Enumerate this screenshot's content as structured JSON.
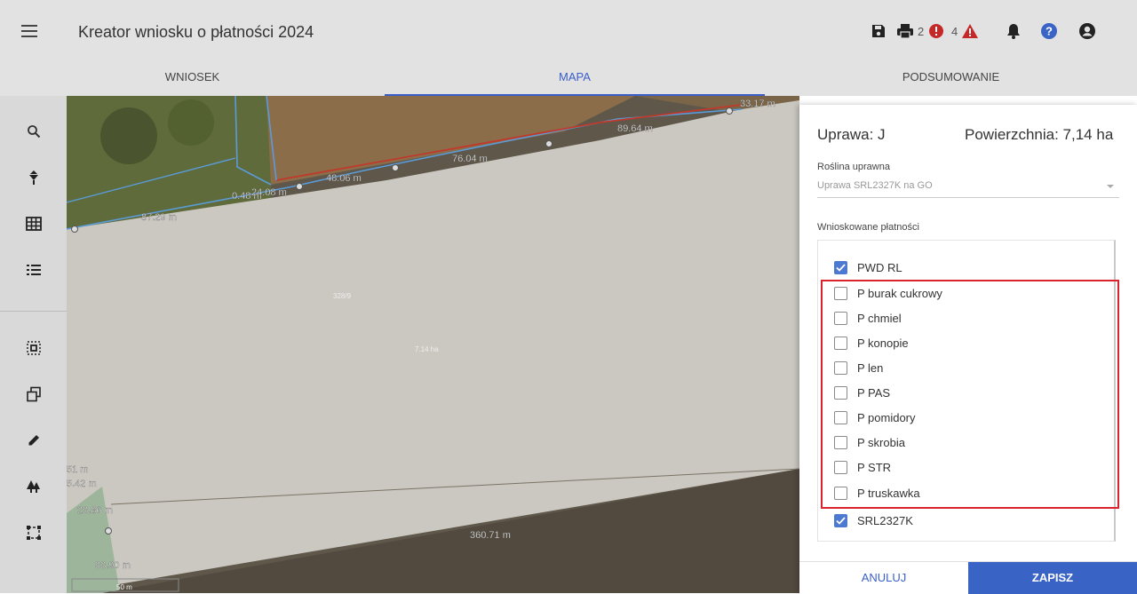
{
  "header": {
    "title": "Kreator wniosku o płatności 2024",
    "error_count": "2",
    "warning_count": "4",
    "icons": [
      "menu-icon",
      "save-icon",
      "print-icon",
      "error-icon",
      "warning-icon",
      "bell-icon",
      "help-icon",
      "user-icon"
    ]
  },
  "tabs": [
    {
      "label": "WNIOSEK",
      "active": false
    },
    {
      "label": "MAPA",
      "active": true
    },
    {
      "label": "PODSUMOWANIE",
      "active": false
    }
  ],
  "sidebar": {
    "tools": [
      "search-icon",
      "pin-icon",
      "grid-icon",
      "list-icon",
      "select-area-icon",
      "copy-icon",
      "pencil-icon",
      "trees-icon",
      "bounding-box-icon"
    ]
  },
  "map": {
    "labels": [
      "87.29 m",
      "0.48 m",
      "24.08 m",
      "48.06 m",
      "76.04 m",
      "89.64 m",
      "33.17 m",
      "328/9",
      "7.14 ha",
      "51 m",
      "5.42 m",
      "23.86 m",
      "33.90 m",
      "360.71 m",
      "50 m"
    ]
  },
  "panel": {
    "crop_label": "Uprawa: J",
    "area_label": "Powierzchnia: 7,14 ha",
    "plant_field_label": "Roślina uprawna",
    "plant_value": "Uprawa SRL2327K na GO",
    "payments_label": "Wnioskowane płatności",
    "payments": [
      {
        "label": "PWD RL",
        "checked": true
      },
      {
        "label": "P burak cukrowy",
        "checked": false
      },
      {
        "label": "P chmiel",
        "checked": false
      },
      {
        "label": "P konopie",
        "checked": false
      },
      {
        "label": "P len",
        "checked": false
      },
      {
        "label": "P PAS",
        "checked": false
      },
      {
        "label": "P pomidory",
        "checked": false
      },
      {
        "label": "P skrobia",
        "checked": false
      },
      {
        "label": "P STR",
        "checked": false
      },
      {
        "label": "P truskawka",
        "checked": false
      },
      {
        "label": "SRL2327K",
        "checked": true
      }
    ],
    "cancel_label": "ANULUJ",
    "save_label": "ZAPISZ"
  },
  "colors": {
    "accent": "#3a63c6",
    "highlight": "#d9232e",
    "error": "#c62828",
    "warning": "#c62828"
  }
}
